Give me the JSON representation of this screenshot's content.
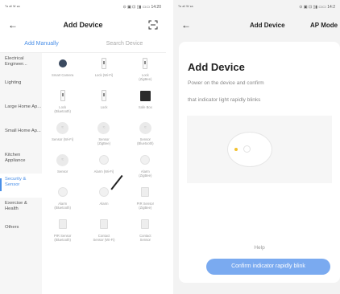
{
  "left": {
    "status_left": "ᵀᵃ ᵃˡˡ ᵂ ᵉᵃ",
    "status_right": "⊙ ▣ ⊡ ▯▮ ▭▭ 14:20",
    "title": "Add Device",
    "tabs": [
      {
        "label": "Add Manually"
      },
      {
        "label": "Search Device"
      }
    ],
    "categories": [
      {
        "label": "Electrical Engineer..."
      },
      {
        "label": "Lighting"
      },
      {
        "label": "Large Home Ap..."
      },
      {
        "label": "Small Home Ap..."
      },
      {
        "label": "Kitchen Appliance"
      },
      {
        "label": "Security & Sensor"
      },
      {
        "label": "Exercise & Health"
      },
      {
        "label": "Others"
      }
    ],
    "devices": [
      {
        "label": "Smart Camera",
        "icon": "camera-icon"
      },
      {
        "label": "Lock (Wi-Fi)",
        "icon": "lock-icon"
      },
      {
        "label": "Lock\n(ZigBee)",
        "icon": "lock-icon"
      },
      {
        "label": "Lock\n(Bluetooth)",
        "icon": "lock-icon"
      },
      {
        "label": "Lock",
        "icon": "lock-icon"
      },
      {
        "label": "Safe Box",
        "icon": "safe-box-icon"
      },
      {
        "label": "Sensor (Wi-Fi)",
        "icon": "sensor-icon"
      },
      {
        "label": "Sensor\n(ZigBee)",
        "icon": "sensor-icon"
      },
      {
        "label": "Sensor\n(Bluetooth)",
        "icon": "sensor-icon"
      },
      {
        "label": "Sensor",
        "icon": "sensor-icon"
      },
      {
        "label": "Alarm (Wi-Fi)",
        "icon": "alarm-icon"
      },
      {
        "label": "Alarm\n(ZigBee)",
        "icon": "alarm-icon"
      },
      {
        "label": "Alarm\n(Bluetooth)",
        "icon": "alarm-icon"
      },
      {
        "label": "Alarm",
        "icon": "alarm-icon"
      },
      {
        "label": "PIR Sensor\n(ZigBee)",
        "icon": "pir-sensor-icon"
      },
      {
        "label": "PIR Sensor\n(Bluetooth)",
        "icon": "pir-sensor-icon"
      },
      {
        "label": "Contact\nSensor (Wi-Fi)",
        "icon": "contact-sensor-icon"
      },
      {
        "label": "Contact\nSensor",
        "icon": "contact-sensor-icon"
      }
    ]
  },
  "right": {
    "status_left": "ᵀᵃ ᵃˡˡ ᵂ ᵉᵃ",
    "status_right": "⊙ ▣ ⊡ ▯▮ ▭▭ 14:2",
    "title": "Add Device",
    "mode": "AP Mode",
    "card_title": "Add Device",
    "desc_line1": "Power on the device and confirm",
    "desc_line2": "that indicator light rapidly blinks",
    "help": "Help",
    "confirm": "Confirm indicator rapidly blink"
  },
  "colors": {
    "accent": "#4a8fe7",
    "button": "#7aaaf0",
    "led": "#f2c230"
  }
}
